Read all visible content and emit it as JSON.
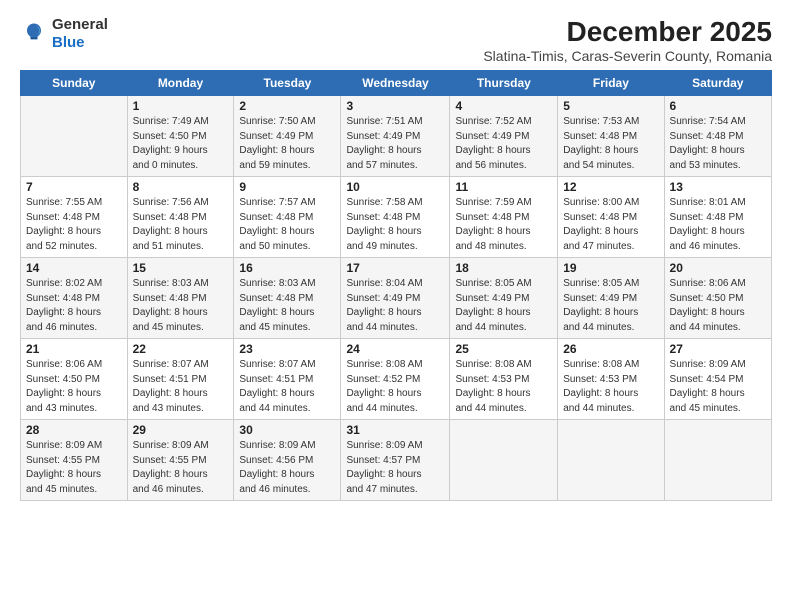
{
  "logo": {
    "general": "General",
    "blue": "Blue"
  },
  "title": "December 2025",
  "subtitle": "Slatina-Timis, Caras-Severin County, Romania",
  "days_header": [
    "Sunday",
    "Monday",
    "Tuesday",
    "Wednesday",
    "Thursday",
    "Friday",
    "Saturday"
  ],
  "weeks": [
    [
      {
        "num": "",
        "info": ""
      },
      {
        "num": "1",
        "info": "Sunrise: 7:49 AM\nSunset: 4:50 PM\nDaylight: 9 hours\nand 0 minutes."
      },
      {
        "num": "2",
        "info": "Sunrise: 7:50 AM\nSunset: 4:49 PM\nDaylight: 8 hours\nand 59 minutes."
      },
      {
        "num": "3",
        "info": "Sunrise: 7:51 AM\nSunset: 4:49 PM\nDaylight: 8 hours\nand 57 minutes."
      },
      {
        "num": "4",
        "info": "Sunrise: 7:52 AM\nSunset: 4:49 PM\nDaylight: 8 hours\nand 56 minutes."
      },
      {
        "num": "5",
        "info": "Sunrise: 7:53 AM\nSunset: 4:48 PM\nDaylight: 8 hours\nand 54 minutes."
      },
      {
        "num": "6",
        "info": "Sunrise: 7:54 AM\nSunset: 4:48 PM\nDaylight: 8 hours\nand 53 minutes."
      }
    ],
    [
      {
        "num": "7",
        "info": "Sunrise: 7:55 AM\nSunset: 4:48 PM\nDaylight: 8 hours\nand 52 minutes."
      },
      {
        "num": "8",
        "info": "Sunrise: 7:56 AM\nSunset: 4:48 PM\nDaylight: 8 hours\nand 51 minutes."
      },
      {
        "num": "9",
        "info": "Sunrise: 7:57 AM\nSunset: 4:48 PM\nDaylight: 8 hours\nand 50 minutes."
      },
      {
        "num": "10",
        "info": "Sunrise: 7:58 AM\nSunset: 4:48 PM\nDaylight: 8 hours\nand 49 minutes."
      },
      {
        "num": "11",
        "info": "Sunrise: 7:59 AM\nSunset: 4:48 PM\nDaylight: 8 hours\nand 48 minutes."
      },
      {
        "num": "12",
        "info": "Sunrise: 8:00 AM\nSunset: 4:48 PM\nDaylight: 8 hours\nand 47 minutes."
      },
      {
        "num": "13",
        "info": "Sunrise: 8:01 AM\nSunset: 4:48 PM\nDaylight: 8 hours\nand 46 minutes."
      }
    ],
    [
      {
        "num": "14",
        "info": "Sunrise: 8:02 AM\nSunset: 4:48 PM\nDaylight: 8 hours\nand 46 minutes."
      },
      {
        "num": "15",
        "info": "Sunrise: 8:03 AM\nSunset: 4:48 PM\nDaylight: 8 hours\nand 45 minutes."
      },
      {
        "num": "16",
        "info": "Sunrise: 8:03 AM\nSunset: 4:48 PM\nDaylight: 8 hours\nand 45 minutes."
      },
      {
        "num": "17",
        "info": "Sunrise: 8:04 AM\nSunset: 4:49 PM\nDaylight: 8 hours\nand 44 minutes."
      },
      {
        "num": "18",
        "info": "Sunrise: 8:05 AM\nSunset: 4:49 PM\nDaylight: 8 hours\nand 44 minutes."
      },
      {
        "num": "19",
        "info": "Sunrise: 8:05 AM\nSunset: 4:49 PM\nDaylight: 8 hours\nand 44 minutes."
      },
      {
        "num": "20",
        "info": "Sunrise: 8:06 AM\nSunset: 4:50 PM\nDaylight: 8 hours\nand 44 minutes."
      }
    ],
    [
      {
        "num": "21",
        "info": "Sunrise: 8:06 AM\nSunset: 4:50 PM\nDaylight: 8 hours\nand 43 minutes."
      },
      {
        "num": "22",
        "info": "Sunrise: 8:07 AM\nSunset: 4:51 PM\nDaylight: 8 hours\nand 43 minutes."
      },
      {
        "num": "23",
        "info": "Sunrise: 8:07 AM\nSunset: 4:51 PM\nDaylight: 8 hours\nand 44 minutes."
      },
      {
        "num": "24",
        "info": "Sunrise: 8:08 AM\nSunset: 4:52 PM\nDaylight: 8 hours\nand 44 minutes."
      },
      {
        "num": "25",
        "info": "Sunrise: 8:08 AM\nSunset: 4:53 PM\nDaylight: 8 hours\nand 44 minutes."
      },
      {
        "num": "26",
        "info": "Sunrise: 8:08 AM\nSunset: 4:53 PM\nDaylight: 8 hours\nand 44 minutes."
      },
      {
        "num": "27",
        "info": "Sunrise: 8:09 AM\nSunset: 4:54 PM\nDaylight: 8 hours\nand 45 minutes."
      }
    ],
    [
      {
        "num": "28",
        "info": "Sunrise: 8:09 AM\nSunset: 4:55 PM\nDaylight: 8 hours\nand 45 minutes."
      },
      {
        "num": "29",
        "info": "Sunrise: 8:09 AM\nSunset: 4:55 PM\nDaylight: 8 hours\nand 46 minutes."
      },
      {
        "num": "30",
        "info": "Sunrise: 8:09 AM\nSunset: 4:56 PM\nDaylight: 8 hours\nand 46 minutes."
      },
      {
        "num": "31",
        "info": "Sunrise: 8:09 AM\nSunset: 4:57 PM\nDaylight: 8 hours\nand 47 minutes."
      },
      {
        "num": "",
        "info": ""
      },
      {
        "num": "",
        "info": ""
      },
      {
        "num": "",
        "info": ""
      }
    ]
  ]
}
